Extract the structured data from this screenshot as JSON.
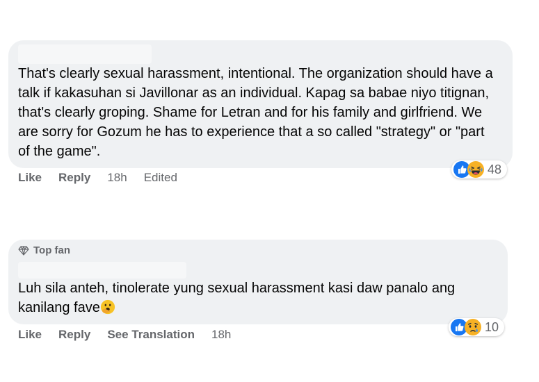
{
  "comments": [
    {
      "badge": "",
      "text": "That's clearly sexual harassment, intentional. The organization should have a talk if kakasuhan si Javillonar as an individual. Kapag sa babae niyo titignan, that's clearly groping. Shame for Letran and for his family and girlfriend. We are sorry for Gozum he has to experience that a so called \"strategy\" or \"part of the game\".",
      "actions": {
        "like": "Like",
        "reply": "Reply",
        "time": "18h",
        "edited": "Edited"
      },
      "reactions": {
        "icons": [
          "like-reaction-icon",
          "haha-reaction-icon"
        ],
        "count": "48"
      }
    },
    {
      "badge": "Top fan",
      "text": "Luh sila anteh, tinolerate yung sexual harassment kasi daw panalo ang kanilang fave",
      "inline_emoji": "face-with-hand-over-mouth-emoji",
      "actions": {
        "like": "Like",
        "reply": "Reply",
        "see_translation": "See Translation",
        "time": "18h"
      },
      "reactions": {
        "icons": [
          "like-reaction-icon",
          "sad-reaction-icon"
        ],
        "count": "10"
      }
    }
  ],
  "colors": {
    "bubble": "#eff1f3",
    "text": "#050505",
    "secondary_text": "#65676b",
    "like_blue": "#1877f2",
    "reaction_yellow": "#f7b125"
  }
}
